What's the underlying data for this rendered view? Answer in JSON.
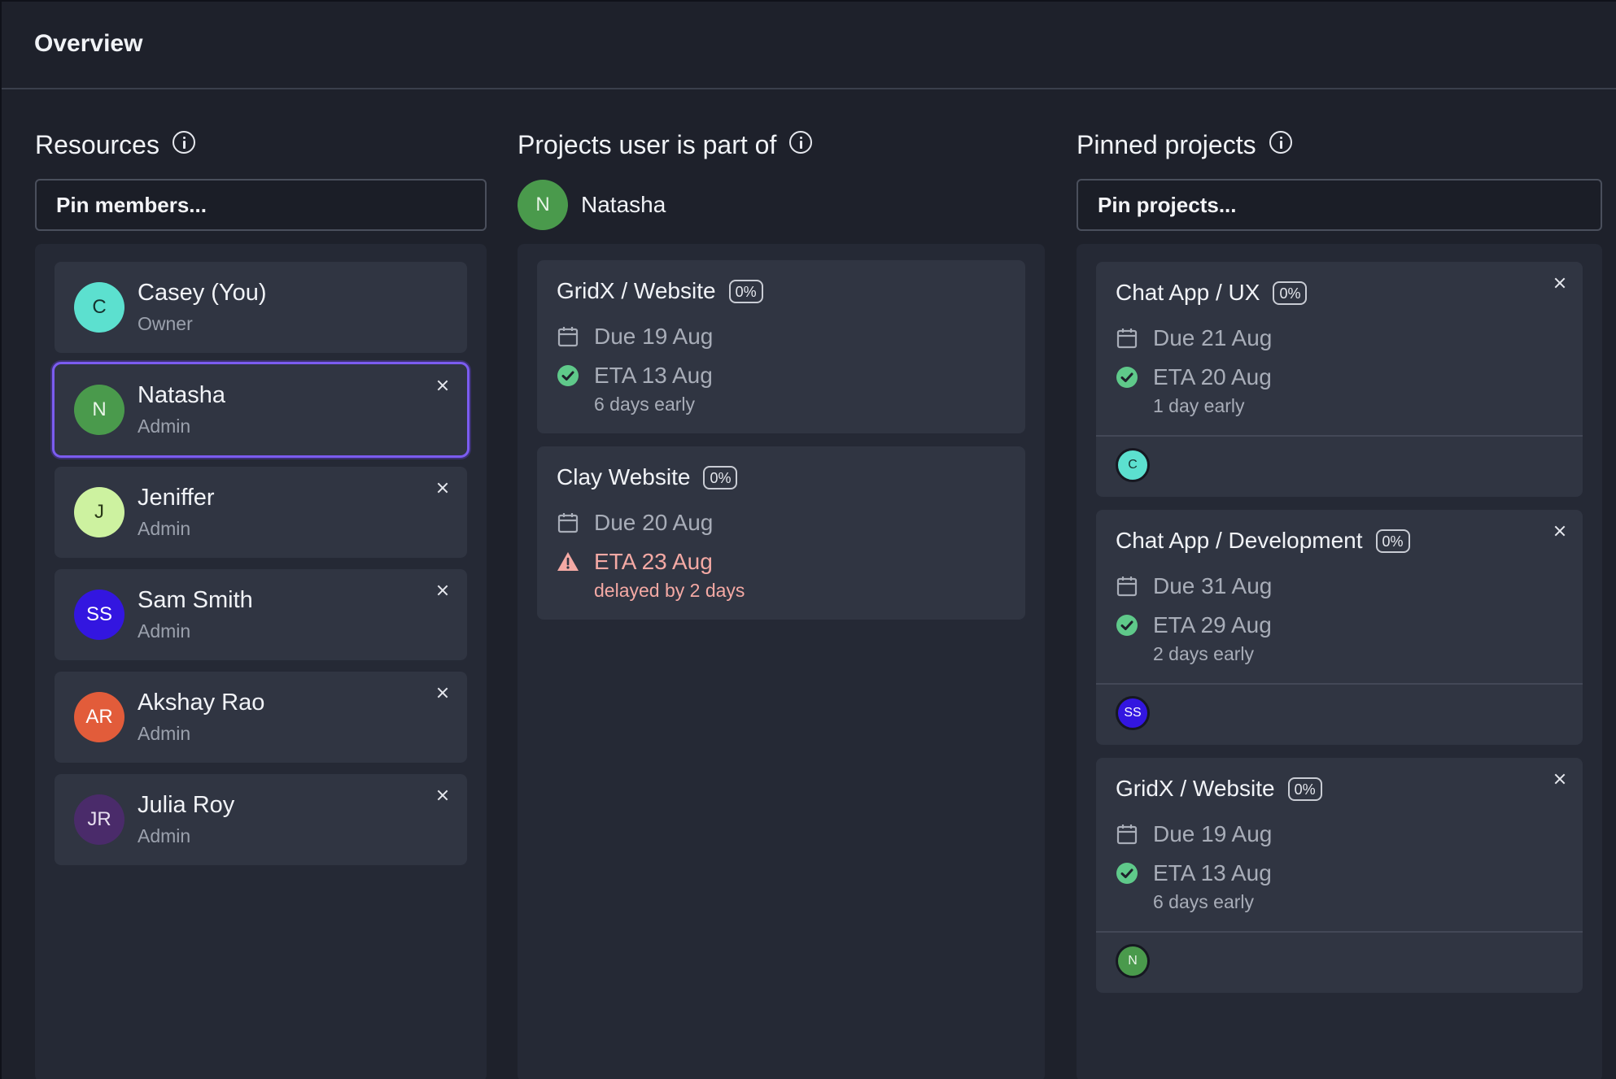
{
  "header": {
    "title": "Overview"
  },
  "resources": {
    "title": "Resources",
    "search_placeholder": "Pin members...",
    "members": [
      {
        "initials": "C",
        "name": "Casey (You)",
        "role": "Owner",
        "color": "#5ce0cf",
        "text_color": "#15332f",
        "removable": false,
        "selected": false
      },
      {
        "initials": "N",
        "name": "Natasha",
        "role": "Admin",
        "color": "#4a9a4c",
        "text_color": "#e9f5e8",
        "removable": true,
        "selected": true
      },
      {
        "initials": "J",
        "name": "Jeniffer",
        "role": "Admin",
        "color": "#cdf2a0",
        "text_color": "#2a3a18",
        "removable": true,
        "selected": false
      },
      {
        "initials": "SS",
        "name": "Sam Smith",
        "role": "Admin",
        "color": "#3316e0",
        "text_color": "#ffffff",
        "removable": true,
        "selected": false
      },
      {
        "initials": "AR",
        "name": "Akshay Rao",
        "role": "Admin",
        "color": "#e25c3a",
        "text_color": "#ffffff",
        "removable": true,
        "selected": false
      },
      {
        "initials": "JR",
        "name": "Julia Roy",
        "role": "Admin",
        "color": "#4a2b6a",
        "text_color": "#e8e0f0",
        "removable": true,
        "selected": false
      }
    ]
  },
  "projects": {
    "title": "Projects user is part of",
    "user": {
      "initials": "N",
      "name": "Natasha",
      "color": "#4a9a4c"
    },
    "items": [
      {
        "name": "GridX / Website",
        "progress": "0%",
        "due": "Due 19 Aug",
        "eta": "ETA 13 Aug",
        "status_note": "6 days early",
        "status": "ok"
      },
      {
        "name": "Clay Website",
        "progress": "0%",
        "due": "Due 20 Aug",
        "eta": "ETA 23 Aug",
        "status_note": "delayed by 2 days",
        "status": "delayed"
      }
    ]
  },
  "pinned": {
    "title": "Pinned projects",
    "search_placeholder": "Pin projects...",
    "items": [
      {
        "name": "Chat App / UX",
        "progress": "0%",
        "due": "Due 21 Aug",
        "eta": "ETA 20 Aug",
        "status_note": "1 day early",
        "status": "ok",
        "member": {
          "initials": "C",
          "color": "#5ce0cf",
          "text_color": "#15332f"
        }
      },
      {
        "name": "Chat App / Development",
        "progress": "0%",
        "due": "Due 31 Aug",
        "eta": "ETA 29 Aug",
        "status_note": "2 days early",
        "status": "ok",
        "member": {
          "initials": "SS",
          "color": "#3316e0",
          "text_color": "#ffffff"
        }
      },
      {
        "name": "GridX / Website",
        "progress": "0%",
        "due": "Due 19 Aug",
        "eta": "ETA 13 Aug",
        "status_note": "6 days early",
        "status": "ok",
        "member": {
          "initials": "N",
          "color": "#4a9a4c",
          "text_color": "#e9f5e8"
        }
      }
    ]
  },
  "icons": {
    "info": "info-icon",
    "close": "close-icon",
    "calendar": "calendar-icon",
    "check": "check-circle-icon",
    "warning": "warning-triangle-icon"
  },
  "colors": {
    "background": "#1e212b",
    "card": "#303542",
    "selected_outline": "#7b5cf0",
    "success": "#5fc98a",
    "warning": "#f4a9a4"
  }
}
